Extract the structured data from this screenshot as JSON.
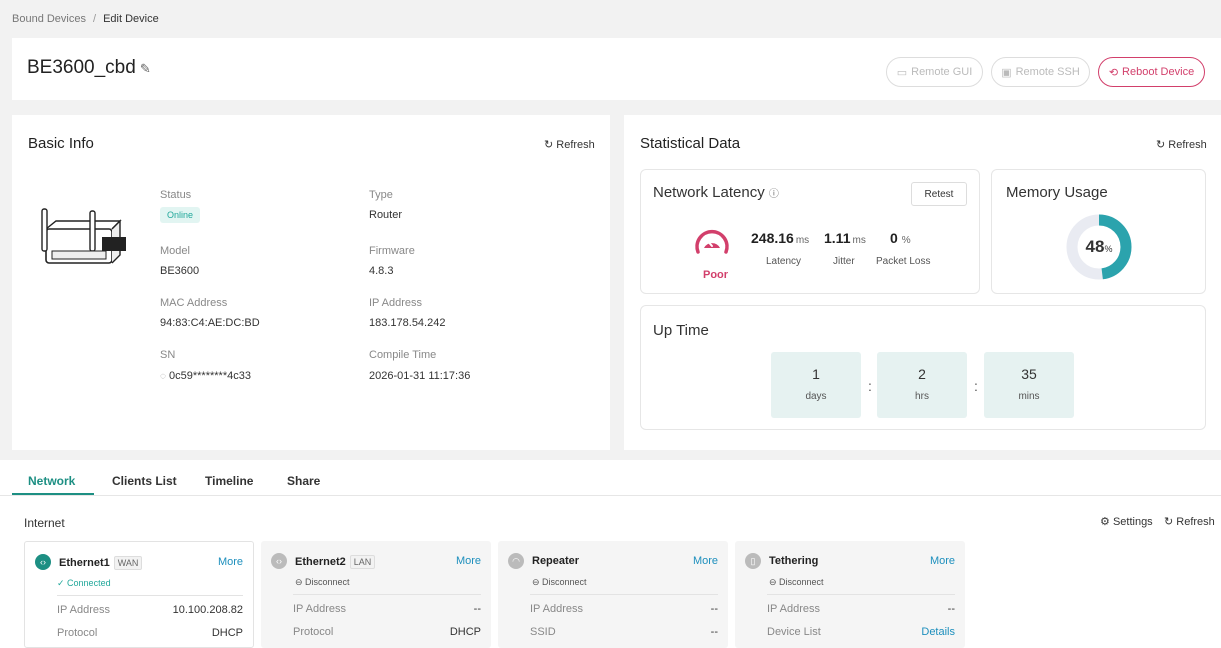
{
  "breadcrumb": {
    "parent": "Bound Devices",
    "separator": "/",
    "current": "Edit Device"
  },
  "device": {
    "name": "BE3600_cbd",
    "edit_icon": "pencil-icon"
  },
  "header_buttons": {
    "remote_gui": "Remote GUI",
    "remote_ssh": "Remote SSH",
    "reboot": "Reboot Device"
  },
  "basic_info": {
    "title": "Basic Info",
    "refresh": "Refresh",
    "status_label": "Status",
    "status_value": "Online",
    "type_label": "Type",
    "type_value": "Router",
    "model_label": "Model",
    "model_value": "BE3600",
    "firmware_label": "Firmware",
    "firmware_value": "4.8.3",
    "mac_label": "MAC Address",
    "mac_value": "94:83:C4:AE:DC:BD",
    "ip_label": "IP Address",
    "ip_value": "183.178.54.242",
    "sn_label": "SN",
    "sn_value": "0c59********4c33",
    "compile_label": "Compile Time",
    "compile_value": "2026-01-31 11:17:36"
  },
  "stats": {
    "title": "Statistical Data",
    "refresh": "Refresh",
    "latency": {
      "title": "Network Latency",
      "retest": "Retest",
      "quality": "Poor",
      "latency_value": "248.16",
      "latency_unit": "ms",
      "latency_label": "Latency",
      "jitter_value": "1.11",
      "jitter_unit": "ms",
      "jitter_label": "Jitter",
      "loss_value": "0",
      "loss_unit": "%",
      "loss_label": "Packet Loss"
    },
    "memory": {
      "title": "Memory Usage",
      "percent": 48,
      "value_text": "48",
      "unit": "%"
    },
    "uptime": {
      "title": "Up Time",
      "days": "1",
      "days_label": "days",
      "hrs": "2",
      "hrs_label": "hrs",
      "mins": "35",
      "mins_label": "mins",
      "colon": ":"
    }
  },
  "tabs": [
    "Network",
    "Clients List",
    "Timeline",
    "Share"
  ],
  "internet": {
    "title": "Internet",
    "settings": "Settings",
    "refresh": "Refresh",
    "cards": [
      {
        "name": "Ethernet1",
        "tag": "WAN",
        "more": "More",
        "status": "✓ Connected",
        "row1_label": "IP Address",
        "row1_value": "10.100.208.82",
        "row2_label": "Protocol",
        "row2_value": "DHCP"
      },
      {
        "name": "Ethernet2",
        "tag": "LAN",
        "more": "More",
        "status": "⊖ Disconnect",
        "row1_label": "IP Address",
        "row1_value": "--",
        "row2_label": "Protocol",
        "row2_value": "DHCP"
      },
      {
        "name": "Repeater",
        "more": "More",
        "status": "⊖ Disconnect",
        "row1_label": "IP Address",
        "row1_value": "--",
        "row2_label": "SSID",
        "row2_value": "--"
      },
      {
        "name": "Tethering",
        "more": "More",
        "status": "⊖ Disconnect",
        "row1_label": "IP Address",
        "row1_value": "--",
        "row2_label": "Device List",
        "row2_value": "Details"
      }
    ]
  },
  "colors": {
    "accent": "#1d8f83",
    "danger": "#d23f6b",
    "link": "#1d8fbd",
    "gauge": "#2ba3ad"
  }
}
